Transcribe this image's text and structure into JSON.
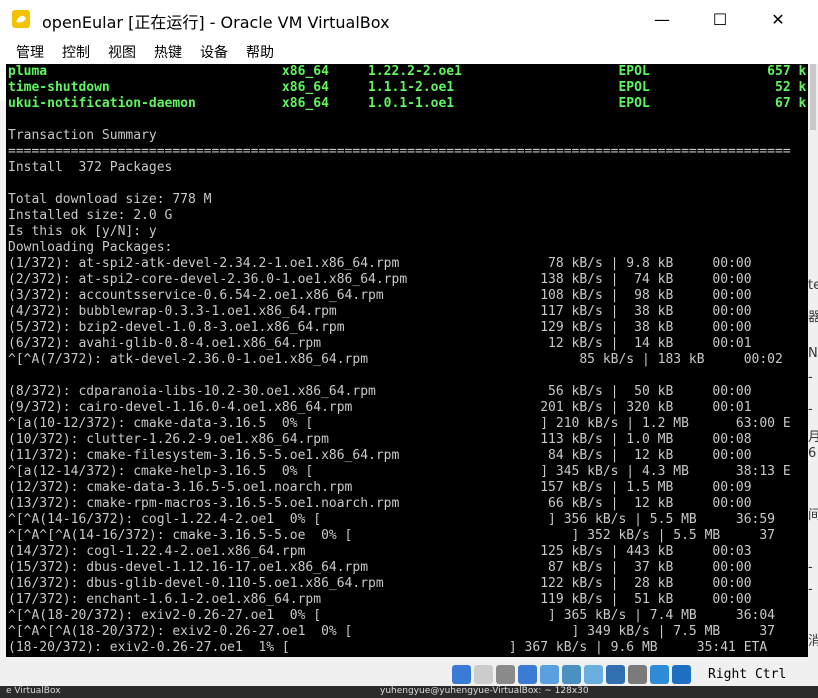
{
  "window": {
    "title": "openEular [正在运行] - Oracle VM VirtualBox",
    "controls": {
      "minimize": "—",
      "maximize": "☐",
      "close": "✕"
    }
  },
  "menu": [
    "管理",
    "控制",
    "视图",
    "热键",
    "设备",
    "帮助"
  ],
  "terminal": {
    "lines": [
      {
        "text": "pluma                              x86_64     1.22.2-2.oe1                    EPOL               657 k",
        "style": "green"
      },
      {
        "text": "time-shutdown                      x86_64     1.1.1-2.oe1                     EPOL                52 k",
        "style": "green"
      },
      {
        "text": "ukui-notification-daemon           x86_64     1.0.1-1.oe1                     EPOL                67 k",
        "style": "green"
      },
      {
        "text": "",
        "style": ""
      },
      {
        "text": "Transaction Summary",
        "style": ""
      },
      {
        "text": "====================================================================================================",
        "style": ""
      },
      {
        "text": "Install  372 Packages",
        "style": ""
      },
      {
        "text": "",
        "style": ""
      },
      {
        "text": "Total download size: 778 M",
        "style": ""
      },
      {
        "text": "Installed size: 2.0 G",
        "style": ""
      },
      {
        "text": "Is this ok [y/N]: y",
        "style": ""
      },
      {
        "text": "Downloading Packages:",
        "style": ""
      },
      {
        "text": "(1/372): at-spi2-atk-devel-2.34.2-1.oe1.x86_64.rpm                   78 kB/s | 9.8 kB     00:00",
        "style": ""
      },
      {
        "text": "(2/372): at-spi2-core-devel-2.36.0-1.oe1.x86_64.rpm                 138 kB/s |  74 kB     00:00",
        "style": ""
      },
      {
        "text": "(3/372): accountsservice-0.6.54-2.oe1.x86_64.rpm                    108 kB/s |  98 kB     00:00",
        "style": ""
      },
      {
        "text": "(4/372): bubblewrap-0.3.3-1.oe1.x86_64.rpm                          117 kB/s |  38 kB     00:00",
        "style": ""
      },
      {
        "text": "(5/372): bzip2-devel-1.0.8-3.oe1.x86_64.rpm                         129 kB/s |  38 kB     00:00",
        "style": ""
      },
      {
        "text": "(6/372): avahi-glib-0.8-4.oe1.x86_64.rpm                             12 kB/s |  14 kB     00:01",
        "style": ""
      },
      {
        "text": "^[^A(7/372): atk-devel-2.36.0-1.oe1.x86_64.rpm                           85 kB/s | 183 kB     00:02",
        "style": ""
      },
      {
        "text": "",
        "style": ""
      },
      {
        "text": "(8/372): cdparanoia-libs-10.2-30.oe1.x86_64.rpm                      56 kB/s |  50 kB     00:00",
        "style": ""
      },
      {
        "text": "(9/372): cairo-devel-1.16.0-4.oe1.x86_64.rpm                        201 kB/s | 320 kB     00:01",
        "style": ""
      },
      {
        "text": "^[a(10-12/372): cmake-data-3.16.5  0% [                             ] 210 kB/s | 1.2 MB      63:00 E",
        "style": ""
      },
      {
        "text": "(10/372): clutter-1.26.2-9.oe1.x86_64.rpm                           113 kB/s | 1.0 MB     00:08",
        "style": ""
      },
      {
        "text": "(11/372): cmake-filesystem-3.16.5-5.oe1.x86_64.rpm                   84 kB/s |  12 kB     00:00",
        "style": ""
      },
      {
        "text": "^[a(12-14/372): cmake-help-3.16.5  0% [                             ] 345 kB/s | 4.3 MB      38:13 E",
        "style": ""
      },
      {
        "text": "(12/372): cmake-data-3.16.5-5.oe1.noarch.rpm                        157 kB/s | 1.5 MB     00:09",
        "style": ""
      },
      {
        "text": "(13/372): cmake-rpm-macros-3.16.5-5.oe1.noarch.rpm                   66 kB/s |  12 kB     00:00",
        "style": ""
      },
      {
        "text": "^[^A(14-16/372): cogl-1.22.4-2.oe1  0% [                             ] 356 kB/s | 5.5 MB     36:59",
        "style": ""
      },
      {
        "text": "^[^A^[^A(14-16/372): cmake-3.16.5-5.oe  0% [                            ] 352 kB/s | 5.5 MB     37",
        "style": ""
      },
      {
        "text": "(14/372): cogl-1.22.4-2.oe1.x86_64.rpm                              125 kB/s | 443 kB     00:03",
        "style": ""
      },
      {
        "text": "(15/372): dbus-devel-1.12.16-17.oe1.x86_64.rpm                       87 kB/s |  37 kB     00:00",
        "style": ""
      },
      {
        "text": "(16/372): dbus-glib-devel-0.110-5.oe1.x86_64.rpm                    122 kB/s |  28 kB     00:00",
        "style": ""
      },
      {
        "text": "(17/372): enchant-1.6.1-2.oe1.x86_64.rpm                            119 kB/s |  51 kB     00:00",
        "style": ""
      },
      {
        "text": "^[^A(18-20/372): exiv2-0.26-27.oe1  0% [                             ] 365 kB/s | 7.4 MB     36:04",
        "style": ""
      },
      {
        "text": "^[^A^[^A(18-20/372): exiv2-0.26-27.oe1  0% [                            ] 349 kB/s | 7.5 MB     37",
        "style": ""
      },
      {
        "text": "(18-20/372): exiv2-0.26-27.oe1  1% [                            ] 367 kB/s | 9.6 MB     35:41 ETA",
        "style": ""
      }
    ]
  },
  "right_edge_glyphs": [
    {
      "text": "te"
    },
    {
      "text": "器"
    },
    {
      "text": "N"
    },
    {
      "text": "-"
    },
    {
      "text": "-"
    },
    {
      "text": "月"
    },
    {
      "text": "6"
    },
    {
      "text": "间"
    },
    {
      "text": "-"
    },
    {
      "text": "-"
    },
    {
      "text": "消"
    }
  ],
  "statusbar": {
    "host_key": "Right Ctrl",
    "icons": [
      "hard-disk-icon",
      "optical-drive-icon",
      "audio-icon",
      "network-icon",
      "usb-icon",
      "shared-folders-icon",
      "display-icon",
      "video-capture-icon",
      "cpu-icon",
      "mouse-integration-icon",
      "keyboard-icon"
    ]
  },
  "host_status": {
    "left": "e VirtualBox",
    "right": "yuhengyue@yuhengyue-VirtualBox: ~   128x30"
  },
  "colors": {
    "terminal_bg": "#000000",
    "terminal_fg": "#c8c8c8",
    "highlight_green": "#5ff55f",
    "titlebar": "#ffffff",
    "statusbar": "#f0f0f0"
  }
}
